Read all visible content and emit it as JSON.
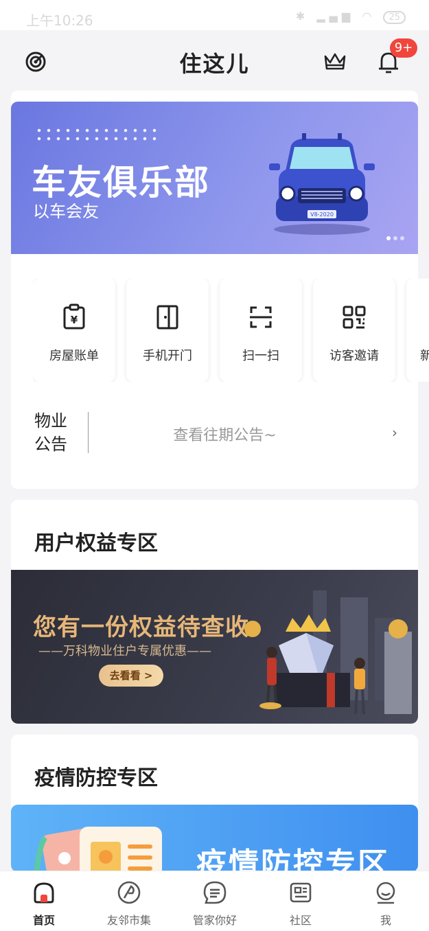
{
  "status_bar": {
    "time": "上午10:26",
    "battery": "25"
  },
  "header": {
    "title": "住这儿",
    "badge": "9+"
  },
  "banner": {
    "title": "车友俱乐部",
    "subtitle": "以车会友",
    "plate": "V8-2020"
  },
  "quick_actions": [
    {
      "label": "房屋账单",
      "icon": "bill-icon"
    },
    {
      "label": "手机开门",
      "icon": "door-icon"
    },
    {
      "label": "扫一扫",
      "icon": "scan-icon"
    },
    {
      "label": "访客邀请",
      "icon": "qrcode-icon"
    },
    {
      "label": "新",
      "icon": "more-icon"
    }
  ],
  "notice": {
    "label_line1": "物业",
    "label_line2": "公告",
    "text": "查看往期公告~"
  },
  "rights_section": {
    "title": "用户权益专区",
    "banner_title": "您有一份权益待查收",
    "banner_subtitle": "——万科物业住户专属优惠——",
    "button": "去看看 >"
  },
  "epidemic_section": {
    "title": "疫情防控专区",
    "banner_title": "疫情防控专区"
  },
  "tabbar": [
    {
      "label": "首页",
      "icon": "home-icon"
    },
    {
      "label": "友邻市集",
      "icon": "market-icon"
    },
    {
      "label": "管家你好",
      "icon": "chat-icon"
    },
    {
      "label": "社区",
      "icon": "community-icon"
    },
    {
      "label": "我",
      "icon": "profile-icon"
    }
  ],
  "colors": {
    "accent_badge": "#f0463c",
    "banner_blue": "#7b86e6",
    "rights_gold": "#e7b778",
    "epidemic_blue": "#4a9af2"
  }
}
